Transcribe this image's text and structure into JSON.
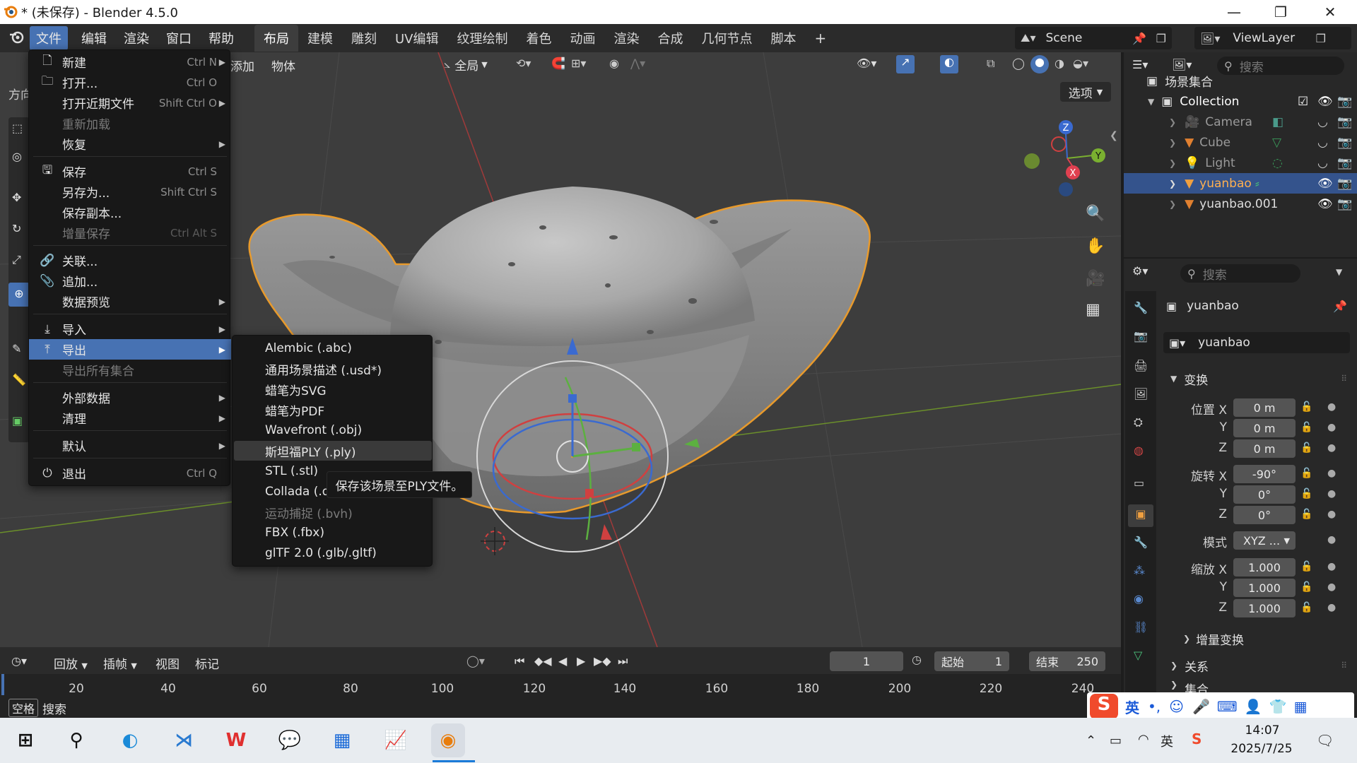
{
  "window": {
    "title": "* (未保存) - Blender 4.5.0",
    "minimize": "—",
    "maximize": "❐",
    "close": "✕"
  },
  "menubar": {
    "items": [
      "文件",
      "编辑",
      "渲染",
      "窗口",
      "帮助"
    ],
    "workspaces": [
      "布局",
      "建模",
      "雕刻",
      "UV编辑",
      "纹理绘制",
      "着色",
      "动画",
      "渲染",
      "合成",
      "几何节点",
      "脚本"
    ],
    "add_workspace": "+",
    "scene_name": "Scene",
    "view_layer": "ViewLayer"
  },
  "viewport_header": {
    "add": "添加",
    "object": "物体",
    "transform_orientation": "全局",
    "options": "选项",
    "left_label": "方向"
  },
  "file_menu": {
    "items": [
      {
        "label": "新建",
        "shortcut": "Ctrl N",
        "submenu": true,
        "icon": "new-file-icon",
        "disabled": false
      },
      {
        "label": "打开...",
        "shortcut": "Ctrl O",
        "submenu": false,
        "icon": "open-folder-icon",
        "disabled": false
      },
      {
        "label": "打开近期文件",
        "shortcut": "Shift Ctrl O",
        "submenu": true,
        "icon": "",
        "disabled": false
      },
      {
        "label": "重新加载",
        "shortcut": "",
        "submenu": false,
        "icon": "",
        "disabled": true
      },
      {
        "label": "恢复",
        "shortcut": "",
        "submenu": true,
        "icon": "",
        "disabled": false
      },
      {
        "label": "保存",
        "shortcut": "Ctrl S",
        "submenu": false,
        "icon": "save-icon",
        "disabled": false
      },
      {
        "label": "另存为...",
        "shortcut": "Shift Ctrl S",
        "submenu": false,
        "icon": "",
        "disabled": false
      },
      {
        "label": "保存副本...",
        "shortcut": "",
        "submenu": false,
        "icon": "",
        "disabled": false
      },
      {
        "label": "增量保存",
        "shortcut": "Ctrl Alt S",
        "submenu": false,
        "icon": "",
        "disabled": true
      },
      {
        "label": "关联...",
        "shortcut": "",
        "submenu": false,
        "icon": "link-icon",
        "disabled": false
      },
      {
        "label": "追加...",
        "shortcut": "",
        "submenu": false,
        "icon": "paperclip-icon",
        "disabled": false
      },
      {
        "label": "数据预览",
        "shortcut": "",
        "submenu": true,
        "icon": "",
        "disabled": false
      },
      {
        "label": "导入",
        "shortcut": "",
        "submenu": true,
        "icon": "import-icon",
        "disabled": false
      },
      {
        "label": "导出",
        "shortcut": "",
        "submenu": true,
        "icon": "export-icon",
        "disabled": false
      },
      {
        "label": "导出所有集合",
        "shortcut": "",
        "submenu": false,
        "icon": "",
        "disabled": true
      },
      {
        "label": "外部数据",
        "shortcut": "",
        "submenu": true,
        "icon": "",
        "disabled": false
      },
      {
        "label": "清理",
        "shortcut": "",
        "submenu": true,
        "icon": "",
        "disabled": false
      },
      {
        "label": "默认",
        "shortcut": "",
        "submenu": true,
        "icon": "",
        "disabled": false
      },
      {
        "label": "退出",
        "shortcut": "Ctrl Q",
        "submenu": false,
        "icon": "power-icon",
        "disabled": false
      }
    ]
  },
  "export_menu": {
    "items": [
      {
        "label": "Alembic (.abc)",
        "disabled": false
      },
      {
        "label": "通用场景描述 (.usd*)",
        "disabled": false
      },
      {
        "label": "蜡笔为SVG",
        "disabled": false
      },
      {
        "label": "蜡笔为PDF",
        "disabled": false
      },
      {
        "label": "Wavefront (.obj)",
        "disabled": false
      },
      {
        "label": "斯坦福PLY (.ply)",
        "disabled": false
      },
      {
        "label": "STL (.stl)",
        "disabled": false
      },
      {
        "label": "Collada (.da",
        "disabled": false
      },
      {
        "label": "运动捕捉 (.bvh)",
        "disabled": true
      },
      {
        "label": "FBX (.fbx)",
        "disabled": false
      },
      {
        "label": "glTF 2.0 (.glb/.gltf)",
        "disabled": false
      }
    ],
    "tooltip": "保存该场景至PLY文件。"
  },
  "outliner": {
    "search_placeholder": "搜索",
    "scene_collection": "场景集合",
    "collection": "Collection",
    "objects": [
      "Camera",
      "Cube",
      "Light",
      "yuanbao",
      "yuanbao.001"
    ]
  },
  "properties": {
    "search_placeholder": "搜索",
    "object_name": "yuanbao",
    "data_name": "yuanbao",
    "transform_header": "变换",
    "location_label": "位置 X",
    "rotation_label": "旋转 X",
    "mode_label": "模式",
    "scale_label": "缩放 X",
    "y_label": "Y",
    "z_label": "Z",
    "location": [
      "0 m",
      "0 m",
      "0 m"
    ],
    "rotation": [
      "-90°",
      "0°",
      "0°"
    ],
    "mode": "XYZ ...",
    "scale": [
      "1.000",
      "1.000",
      "1.000"
    ],
    "delta_transform": "增量变换",
    "relations": "关系",
    "collections": "集合"
  },
  "timeline": {
    "playback": "回放",
    "keying": "插帧",
    "view": "视图",
    "marker": "标记",
    "current_frame": "1",
    "start_label": "起始",
    "start": "1",
    "end_label": "结束",
    "end": "250",
    "ticks": [
      "20",
      "40",
      "60",
      "80",
      "100",
      "120",
      "140",
      "160",
      "180",
      "200",
      "220",
      "240"
    ]
  },
  "statusbar": {
    "key": "空格",
    "action": "搜索"
  },
  "taskbar": {
    "time": "14:07",
    "date": "2025/7/25",
    "ime_lang": "英",
    "ime_tray": "英"
  }
}
